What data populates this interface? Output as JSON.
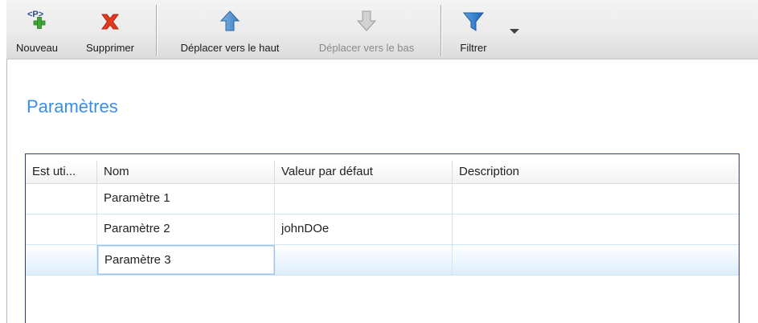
{
  "toolbar": {
    "new_label": "Nouveau",
    "delete_label": "Supprimer",
    "move_up_label": "Déplacer vers le haut",
    "move_down_label": "Déplacer vers le bas",
    "filter_label": "Filtrer",
    "new_icon_text": "<P>",
    "icons": [
      "new-parameter-icon",
      "delete-icon",
      "arrow-up-icon",
      "arrow-down-icon",
      "filter-icon",
      "dropdown-arrow-icon"
    ],
    "move_down_enabled": false
  },
  "section": {
    "title": "Paramètres"
  },
  "grid": {
    "columns": [
      "Est uti...",
      "Nom",
      "Valeur par défaut",
      "Description"
    ],
    "rows": [
      {
        "used": "",
        "name": "Paramètre 1",
        "default": "",
        "description": ""
      },
      {
        "used": "",
        "name": "Paramètre 2",
        "default": "johnDOe",
        "description": ""
      },
      {
        "used": "",
        "name": "Paramètre 3",
        "default": "",
        "description": "",
        "selected": true
      }
    ]
  },
  "colors": {
    "title": "#3a8ee6",
    "grid_border": "#2c3a8c",
    "delete_red": "#e23a1e",
    "arrow_up_blue": "#4a88c8",
    "filter_blue": "#2f7fd0",
    "add_green": "#3fa535"
  }
}
